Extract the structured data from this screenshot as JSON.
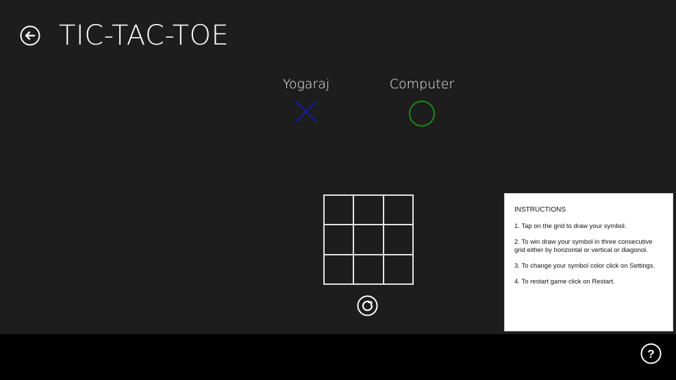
{
  "header": {
    "title": "TIC-TAC-TOE",
    "back_icon": "back-arrow-icon"
  },
  "players": [
    {
      "name": "Yogaraj",
      "symbol": "X",
      "color": "#1a1aa6"
    },
    {
      "name": "Computer",
      "symbol": "O",
      "color": "#1a8a1a"
    }
  ],
  "board": {
    "cells": [
      "",
      "",
      "",
      "",
      "",
      "",
      "",
      "",
      ""
    ]
  },
  "restart": {
    "icon": "restart-icon"
  },
  "instructions": {
    "title": "INSTRUCTIONS",
    "items": [
      "1. Tap on the grid to draw your symbol.",
      "2. To win draw your symbol in three consecutive grid either by horizontal or vertical or diagonol.",
      "3. To change your symbol color click on Settings.",
      "4. To restart game click on Restart."
    ]
  },
  "app_bar": {
    "help_icon": "help-icon",
    "help_glyph": "?"
  }
}
